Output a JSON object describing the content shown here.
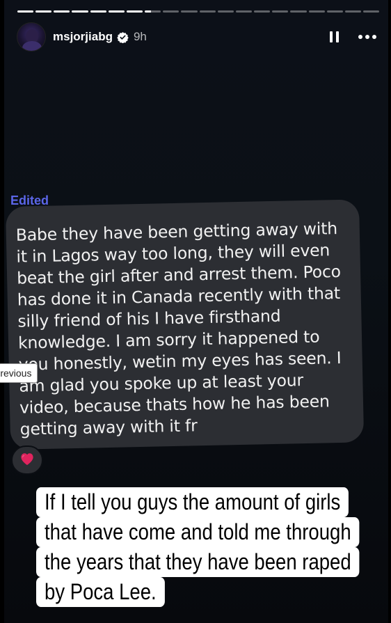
{
  "story": {
    "progress": {
      "total_segments": 20,
      "completed_segments": 7,
      "current_segment_fill": 0.4
    },
    "header": {
      "username": "msjorjiabg",
      "verified": true,
      "time": "9h",
      "icons": [
        "avatar",
        "verified-badge-icon",
        "pause-icon",
        "more-options-icon"
      ]
    },
    "message": {
      "edited_label": "Edited",
      "text": "Babe they have been getting away with it in Lagos way too long, they will even beat the girl after and arrest them. Poco has done it in Canada recently with that silly friend of his I have firsthand knowledge. I am sorry it happened to you honestly, wetin my eyes has seen. I am glad you spoke up at least your video, because thats how he has been getting away with it fr",
      "reaction": "❤️"
    },
    "tooltip": {
      "text": "Previous"
    },
    "caption": {
      "lines": [
        "If I tell you guys the amount of girls",
        "that have come and told me through",
        "the years that they have been raped",
        "by Poca Lee."
      ]
    },
    "colors": {
      "background": "#0b1016",
      "bubble": "#2c2e33",
      "edited": "#5b66e8",
      "caption_bg": "#ffffff"
    }
  }
}
